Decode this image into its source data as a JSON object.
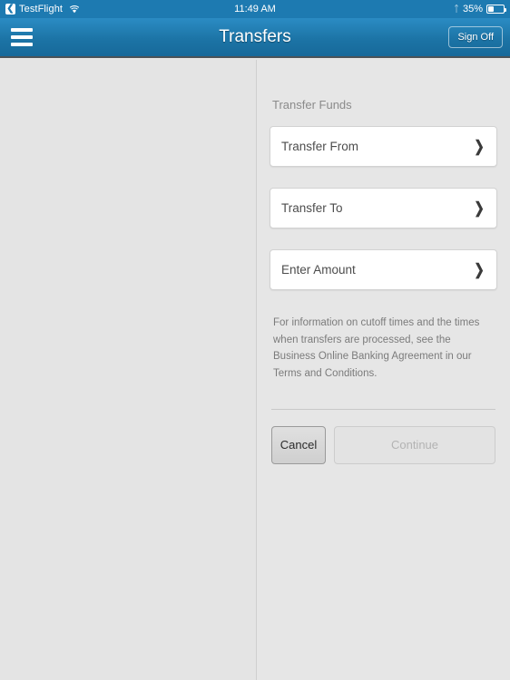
{
  "status_bar": {
    "back_label": "TestFlight",
    "back_icon": "chevron-left-icon",
    "wifi_icon": "wifi-icon",
    "time": "11:49 AM",
    "bluetooth_icon": "bluetooth-icon",
    "battery_percent": "35%"
  },
  "nav_bar": {
    "menu_icon": "hamburger-menu-icon",
    "title": "Transfers",
    "sign_off_label": "Sign Off",
    "background_color": "#1c74a6"
  },
  "main": {
    "section_label": "Transfer Funds",
    "fields": [
      {
        "label": "Transfer From",
        "chevron": "❯"
      },
      {
        "label": "Transfer To",
        "chevron": "❯"
      },
      {
        "label": "Enter Amount",
        "chevron": "❯"
      }
    ],
    "info_text": "For information on cutoff times and the times when transfers are processed, see the Business Online Banking Agreement in our Terms and Conditions.",
    "buttons": {
      "cancel_label": "Cancel",
      "continue_label": "Continue"
    }
  }
}
